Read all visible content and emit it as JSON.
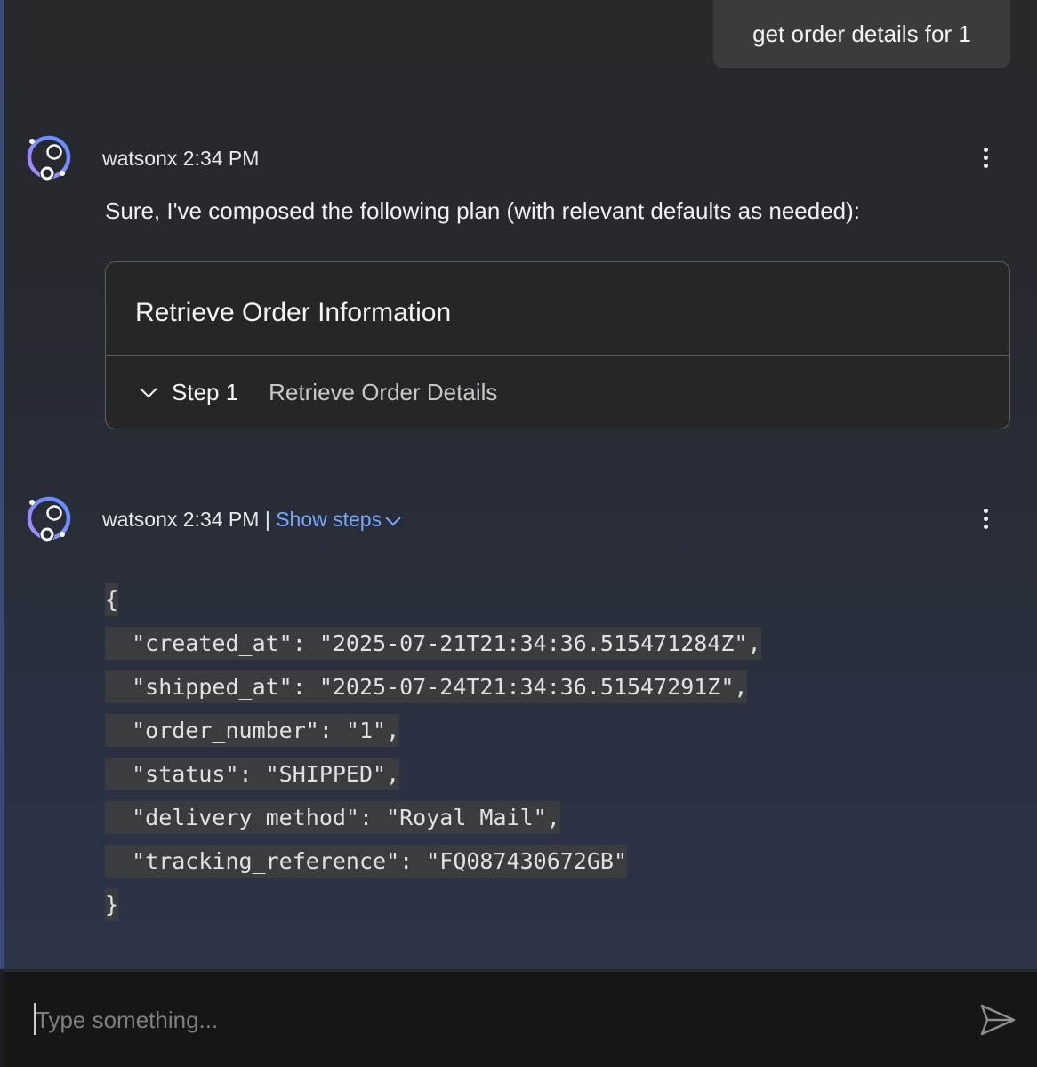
{
  "conversation": {
    "user_message": "get order details for 1",
    "messages": [
      {
        "sender": "watsonx",
        "time": "2:34 PM",
        "intro": "Sure, I've composed the following plan (with relevant defaults as needed):",
        "plan": {
          "title": "Retrieve Order Information",
          "step_label": "Step 1",
          "step_description": "Retrieve Order Details"
        }
      },
      {
        "sender": "watsonx",
        "time": "2:34 PM",
        "separator": "|",
        "show_steps": "Show steps",
        "code_lines": [
          "{",
          "  \"created_at\": \"2025-07-21T21:34:36.515471284Z\",",
          "  \"shipped_at\": \"2025-07-24T21:34:36.51547291Z\",",
          "  \"order_number\": \"1\",",
          "  \"status\": \"SHIPPED\",",
          "  \"delivery_method\": \"Royal Mail\",",
          "  \"tracking_reference\": \"FQ087430672GB\"",
          "}"
        ]
      }
    ]
  },
  "composer": {
    "placeholder": "Type something..."
  },
  "icons": {
    "avatar": "watsonx-avatar-icon",
    "overflow": "overflow-menu-vertical-icon",
    "chevron": "chevron-down-icon",
    "send": "send-icon"
  },
  "colors": {
    "accent_link": "#78a9ff",
    "avatar_purple": "#8a6cf0"
  }
}
